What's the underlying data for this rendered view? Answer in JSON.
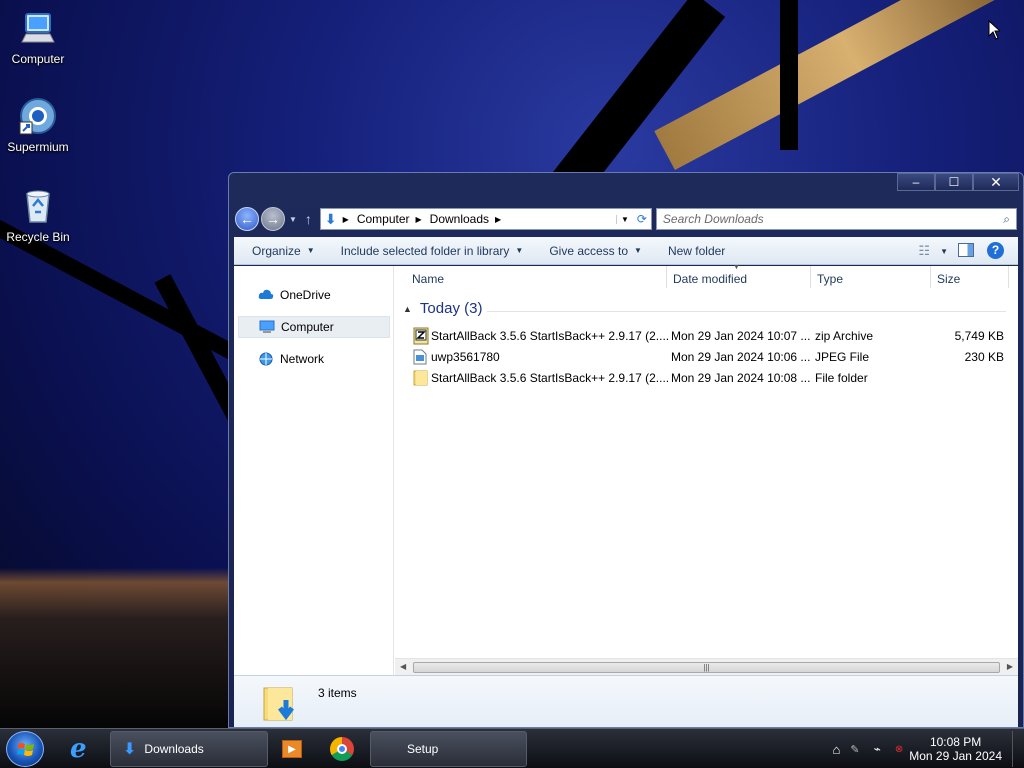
{
  "desktop": {
    "icons": [
      {
        "label": "Computer",
        "icon": "computer-icon"
      },
      {
        "label": "Supermium",
        "icon": "supermium-icon"
      },
      {
        "label": "Recycle Bin",
        "icon": "recycle-bin-icon"
      }
    ]
  },
  "window": {
    "controls": {
      "minimize": "–",
      "maximize": "☐",
      "close": "✕"
    },
    "address": {
      "segments": [
        "Computer",
        "Downloads"
      ]
    },
    "search": {
      "placeholder": "Search Downloads"
    },
    "toolbar": {
      "organize": "Organize",
      "include_library": "Include selected folder in library",
      "give_access": "Give access to",
      "new_folder": "New folder"
    },
    "nav_pane": {
      "items": [
        {
          "label": "OneDrive",
          "icon": "onedrive-icon"
        },
        {
          "label": "Computer",
          "icon": "computer-icon",
          "selected": true
        },
        {
          "label": "Network",
          "icon": "network-icon"
        }
      ]
    },
    "columns": {
      "name": "Name",
      "date": "Date modified",
      "type": "Type",
      "size": "Size"
    },
    "group": {
      "label": "Today (3)"
    },
    "files": [
      {
        "name": "StartAllBack 3.5.6 StartIsBack++ 2.9.17 (2....",
        "date": "Mon 29 Jan 2024 10:07 ...",
        "type": "zip Archive",
        "size": "5,749 KB",
        "icon": "zip-file-icon"
      },
      {
        "name": "uwp3561780",
        "date": "Mon 29 Jan 2024 10:06 ...",
        "type": "JPEG File",
        "size": "230 KB",
        "icon": "image-file-icon"
      },
      {
        "name": "StartAllBack 3.5.6 StartIsBack++ 2.9.17 (2....",
        "date": "Mon 29 Jan 2024 10:08 ...",
        "type": "File folder",
        "size": "",
        "icon": "folder-icon"
      }
    ],
    "status": {
      "item_count": "3 items"
    }
  },
  "taskbar": {
    "items": [
      {
        "label": "",
        "icon": "internet-explorer-icon"
      },
      {
        "label": "Downloads",
        "icon": "downloads-folder-icon"
      },
      {
        "label": "",
        "icon": "media-player-icon"
      },
      {
        "label": "",
        "icon": "chrome-icon"
      },
      {
        "label": "Setup",
        "icon": ""
      }
    ],
    "clock": {
      "time": "10:08 PM",
      "date": "Mon 29 Jan 2024"
    }
  }
}
